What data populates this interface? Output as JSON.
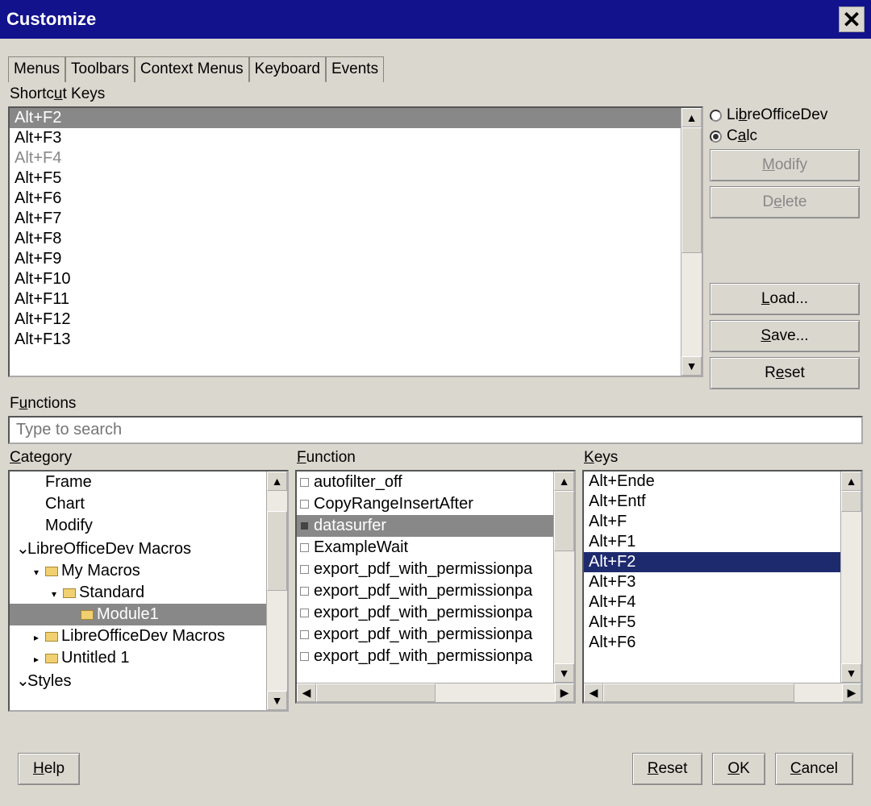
{
  "window": {
    "title": "Customize"
  },
  "tabs": [
    "Menus",
    "Toolbars",
    "Context Menus",
    "Keyboard",
    "Events"
  ],
  "active_tab": 3,
  "sections": {
    "shortcut_keys": "Shortcut Keys",
    "functions": "Functions",
    "category": "Category",
    "function": "Function",
    "keys": "Keys"
  },
  "shortcut_list": {
    "items": [
      "Alt+F2",
      "Alt+F3",
      "Alt+F4",
      "Alt+F5",
      "Alt+F6",
      "Alt+F7",
      "Alt+F8",
      "Alt+F9",
      "Alt+F10",
      "Alt+F11",
      "Alt+F12",
      "Alt+F13"
    ],
    "selected_index": 0,
    "disabled_index": 2
  },
  "scope": {
    "option1": "LibreOfficeDev",
    "option2": "Calc",
    "selected": 1
  },
  "buttons": {
    "modify": "Modify",
    "delete": "Delete",
    "load": "Load...",
    "save": "Save...",
    "reset_top": "Reset"
  },
  "search": {
    "placeholder": "Type to search"
  },
  "category_tree": [
    {
      "label": "Frame",
      "indent": 1
    },
    {
      "label": "Chart",
      "indent": 1
    },
    {
      "label": "Modify",
      "indent": 1
    },
    {
      "label": "LibreOfficeDev Macros",
      "indent": 0,
      "caret": "open"
    },
    {
      "label": "My Macros",
      "indent": 1,
      "icon": true,
      "caret": "open-sm"
    },
    {
      "label": "Standard",
      "indent": 2,
      "icon": true,
      "caret": "open-sm"
    },
    {
      "label": "Module1",
      "indent": 3,
      "icon": true,
      "selected": true
    },
    {
      "label": "LibreOfficeDev Macros",
      "indent": 1,
      "icon": true,
      "caret": "closed-sm"
    },
    {
      "label": "Untitled 1",
      "indent": 1,
      "icon": true,
      "caret": "closed-sm"
    },
    {
      "label": "Styles",
      "indent": 0,
      "caret": "open"
    }
  ],
  "function_list": {
    "items": [
      "autofilter_off",
      "CopyRangeInsertAfter",
      "datasurfer",
      "ExampleWait",
      "export_pdf_with_permissionpa",
      "export_pdf_with_permissionpa",
      "export_pdf_with_permissionpa",
      "export_pdf_with_permissionpa",
      "export_pdf_with_permissionpa"
    ],
    "selected_index": 2
  },
  "keys_list": {
    "items": [
      "Alt+Ende",
      "Alt+Entf",
      "Alt+F",
      "Alt+F1",
      "Alt+F2",
      "Alt+F3",
      "Alt+F4",
      "Alt+F5",
      "Alt+F6"
    ],
    "selected_index": 4
  },
  "bottom": {
    "help": "Help",
    "reset": "Reset",
    "ok": "OK",
    "cancel": "Cancel"
  }
}
